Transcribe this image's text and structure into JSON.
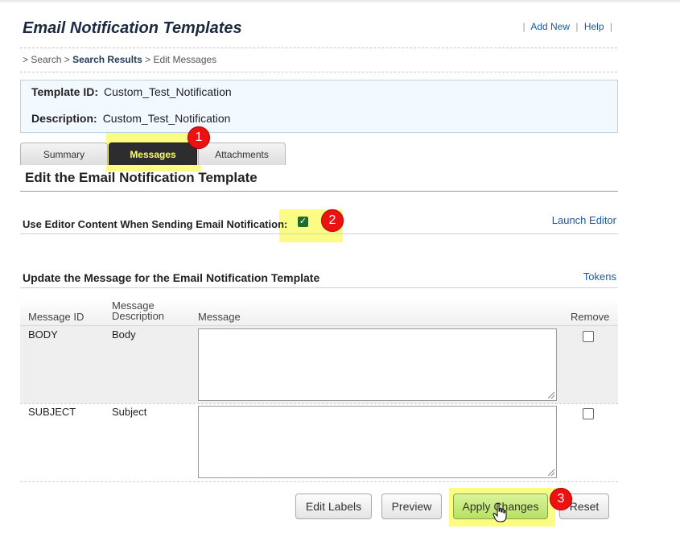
{
  "header": {
    "title": "Email Notification Templates",
    "links": [
      "Add New",
      "Help"
    ]
  },
  "breadcrumb": {
    "lead": "> Search >",
    "search_results": "Search Results",
    "current": "> Edit Messages"
  },
  "template": {
    "id_label": "Template ID:",
    "id_value": "Custom_Test_Notification",
    "desc_label": "Description:",
    "desc_value": "Custom_Test_Notification"
  },
  "tabs": [
    {
      "label": "Summary",
      "active": false
    },
    {
      "label": "Messages",
      "active": true
    },
    {
      "label": "Attachments",
      "active": false
    }
  ],
  "section_title": "Edit the Email Notification Template",
  "editor_option": {
    "label": "Use Editor Content When Sending Email Notification:",
    "checked": true,
    "launch_editor": "Launch Editor"
  },
  "update_section": {
    "title": "Update the Message for the Email Notification Template",
    "tokens_link": "Tokens"
  },
  "table": {
    "headers": {
      "message_id": "Message ID",
      "message_description_1": "Message",
      "message_description_2": "Description",
      "message": "Message",
      "remove": "Remove"
    },
    "rows": [
      {
        "id": "BODY",
        "description": "Body",
        "message": "",
        "remove": false
      },
      {
        "id": "SUBJECT",
        "description": "Subject",
        "message": "",
        "remove": false
      }
    ]
  },
  "buttons": {
    "edit_labels": "Edit Labels",
    "preview": "Preview",
    "apply_changes": "Apply Changes",
    "reset": "Reset"
  },
  "callouts": [
    "1",
    "2",
    "3"
  ],
  "colors": {
    "highlight": "#fbfb6e",
    "callout": "#ee1111",
    "active_tab_bg": "#2d2d2d",
    "active_tab_text": "#ffff66",
    "link": "#1a5a9c",
    "primary_button": "#c6eb7a"
  }
}
